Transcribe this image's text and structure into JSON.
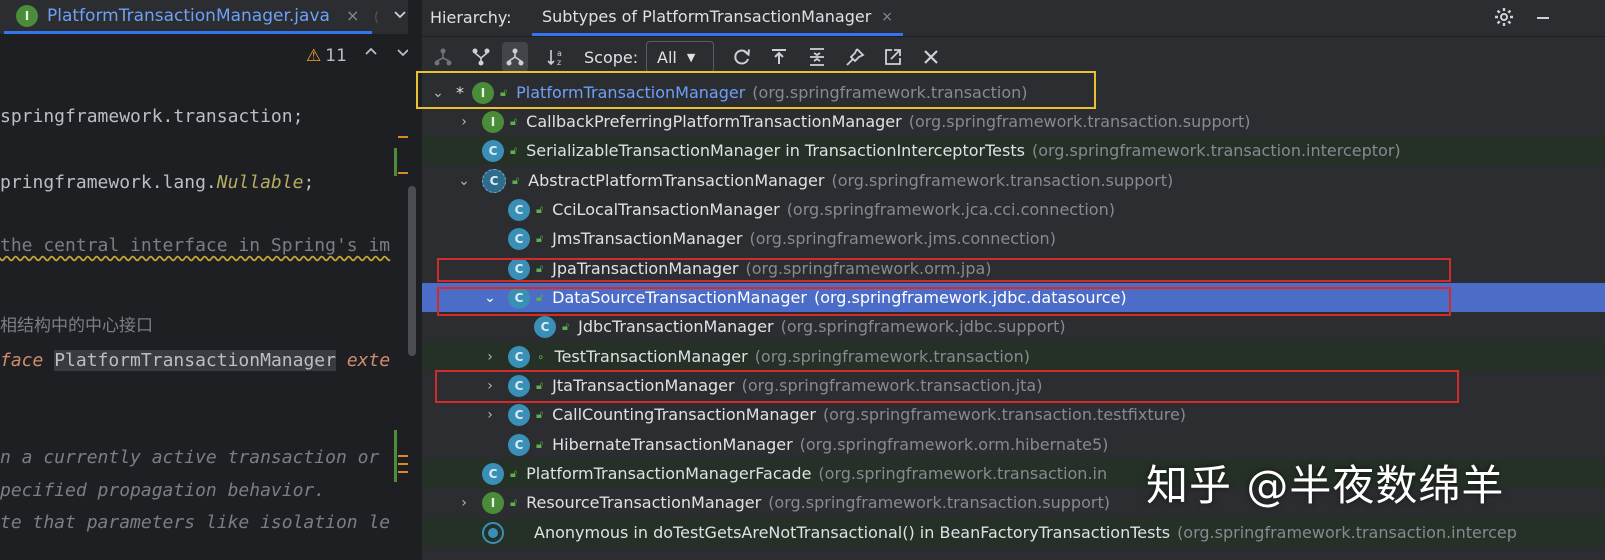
{
  "editor": {
    "tab_title": "PlatformTransactionManager.java",
    "tab_close": "×",
    "tab_overflow": "(",
    "warning_count": "11",
    "lines": {
      "l1": "springframework.transaction;",
      "l2_prefix": "pringframework.lang.",
      "l2_ann": "Nullable",
      "l2_suffix": ";",
      "l3": "the central interface in Spring's im",
      "l4": "相结构中的中心接口",
      "l5_kw": "face",
      "l5_type": "PlatformTransactionManager",
      "l5_ext": "exte",
      "l6": "n a currently active transaction or",
      "l7": "pecified propagation behavior.",
      "l8": "te that parameters like isolation le"
    }
  },
  "hierarchy": {
    "title": "Hierarchy:",
    "tab_label": "Subtypes of PlatformTransactionManager",
    "tab_close": "×",
    "scope_label": "Scope:",
    "scope_value": "All",
    "icons": {
      "settings": "gear-icon",
      "minimize": "minimize-icon"
    },
    "rows": [
      {
        "name": "PlatformTransactionManager",
        "pkg": "(org.springframework.transaction)",
        "icon": "I",
        "chev": "⌄",
        "star": "*"
      },
      {
        "name": "CallbackPreferringPlatformTransactionManager",
        "pkg": "(org.springframework.transaction.support)",
        "icon": "I",
        "chev": "›"
      },
      {
        "name": "SerializableTransactionManager in TransactionInterceptorTests",
        "pkg": "(org.springframework.transaction.interceptor)",
        "icon": "C"
      },
      {
        "name": "AbstractPlatformTransactionManager",
        "pkg": "(org.springframework.transaction.support)",
        "icon": "C",
        "chev": "⌄"
      },
      {
        "name": "CciLocalTransactionManager",
        "pkg": "(org.springframework.jca.cci.connection)",
        "icon": "C"
      },
      {
        "name": "JmsTransactionManager",
        "pkg": "(org.springframework.jms.connection)",
        "icon": "C"
      },
      {
        "name": "JpaTransactionManager",
        "pkg": "(org.springframework.orm.jpa)",
        "icon": "C"
      },
      {
        "name": "DataSourceTransactionManager",
        "pkg": "(org.springframework.jdbc.datasource)",
        "icon": "C",
        "chev": "⌄"
      },
      {
        "name": "JdbcTransactionManager",
        "pkg": "(org.springframework.jdbc.support)",
        "icon": "C"
      },
      {
        "name": "TestTransactionManager",
        "pkg": "(org.springframework.transaction)",
        "icon": "C",
        "chev": "›"
      },
      {
        "name": "JtaTransactionManager",
        "pkg": "(org.springframework.transaction.jta)",
        "icon": "C",
        "chev": "›"
      },
      {
        "name": "CallCountingTransactionManager",
        "pkg": "(org.springframework.transaction.testfixture)",
        "icon": "C",
        "chev": "›"
      },
      {
        "name": "HibernateTransactionManager",
        "pkg": "(org.springframework.orm.hibernate5)",
        "icon": "C"
      },
      {
        "name": "PlatformTransactionManagerFacade",
        "pkg": "(org.springframework.transaction.in",
        "icon": "C"
      },
      {
        "name": "ResourceTransactionManager",
        "pkg": "(org.springframework.transaction.support)",
        "icon": "I",
        "chev": "›"
      },
      {
        "name": "Anonymous in doTestGetsAreNotTransactional() in BeanFactoryTransactionTests",
        "pkg": "(org.springframework.transaction.intercep",
        "icon": "anon"
      }
    ]
  },
  "watermark": "知乎 @半夜数绵羊",
  "colors": {
    "accent": "#3574f0",
    "selected_row": "#4b6cc7",
    "highlight_yellow": "#e8c232",
    "highlight_red": "#d32a2a",
    "lock_green": "#5fb04b"
  }
}
